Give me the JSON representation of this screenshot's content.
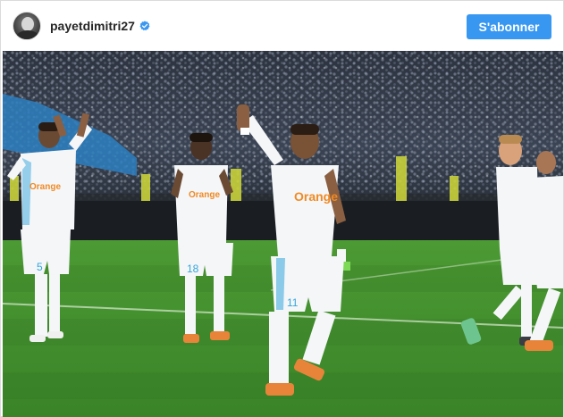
{
  "post": {
    "username": "payetdimitri27",
    "verified": true,
    "follow_label": "S'abonner"
  },
  "photo": {
    "jersey_text": "Orange",
    "numbers": [
      "5",
      "18",
      "11"
    ]
  },
  "colors": {
    "follow_button": "#3897f0",
    "verified_badge": "#3897f0",
    "pitch": "#3f8a2a",
    "jersey": "#f4f6f8",
    "jersey_accent": "#35a6dc",
    "boots": "#e8843a"
  },
  "icons": {
    "verified": "verified-badge-icon"
  }
}
